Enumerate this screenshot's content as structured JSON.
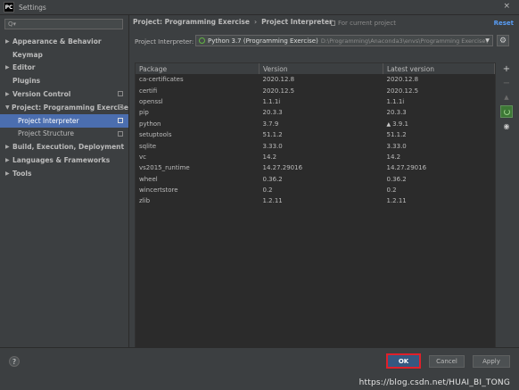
{
  "window": {
    "title": "Settings",
    "app_icon": "PC",
    "close_icon": "×"
  },
  "search": {
    "icon": "Q▾",
    "value": ""
  },
  "sidebar": {
    "items": [
      {
        "label": "Appearance & Behavior",
        "arrow": "▶"
      },
      {
        "label": "Keymap",
        "arrow": ""
      },
      {
        "label": "Editor",
        "arrow": "▶"
      },
      {
        "label": "Plugins",
        "arrow": ""
      },
      {
        "label": "Version Control",
        "arrow": "▶"
      },
      {
        "label": "Project: Programming Exercise",
        "arrow": "▼"
      },
      {
        "label": "Project Interpreter",
        "arrow": ""
      },
      {
        "label": "Project Structure",
        "arrow": ""
      },
      {
        "label": "Build, Execution, Deployment",
        "arrow": "▶"
      },
      {
        "label": "Languages & Frameworks",
        "arrow": "▶"
      },
      {
        "label": "Tools",
        "arrow": "▶"
      }
    ]
  },
  "header": {
    "crumb_project": "Project: Programming Exercise",
    "crumb_sep": "›",
    "crumb_page": "Project Interpreter",
    "current_project": "For current project",
    "reset": "Reset"
  },
  "interpreter": {
    "label": "Project Interpreter:",
    "name": "Python 3.7 (Programming Exercise)",
    "path": "D:\\Programming\\Anaconda3\\envs\\Programming Exercise\\",
    "dropdown_icon": "▼",
    "gear_icon": "⚙"
  },
  "table": {
    "columns": [
      "Package",
      "Version",
      "Latest version"
    ],
    "upgrade_icon": "▲",
    "rows": [
      {
        "package": "ca-certificates",
        "version": "2020.12.8",
        "latest": "2020.12.8",
        "upgrade": false
      },
      {
        "package": "certifi",
        "version": "2020.12.5",
        "latest": "2020.12.5",
        "upgrade": false
      },
      {
        "package": "openssl",
        "version": "1.1.1i",
        "latest": "1.1.1i",
        "upgrade": false
      },
      {
        "package": "pip",
        "version": "20.3.3",
        "latest": "20.3.3",
        "upgrade": false
      },
      {
        "package": "python",
        "version": "3.7.9",
        "latest": "3.9.1",
        "upgrade": true
      },
      {
        "package": "setuptools",
        "version": "51.1.2",
        "latest": "51.1.2",
        "upgrade": false
      },
      {
        "package": "sqlite",
        "version": "3.33.0",
        "latest": "3.33.0",
        "upgrade": false
      },
      {
        "package": "vc",
        "version": "14.2",
        "latest": "14.2",
        "upgrade": false
      },
      {
        "package": "vs2015_runtime",
        "version": "14.27.29016",
        "latest": "14.27.29016",
        "upgrade": false
      },
      {
        "package": "wheel",
        "version": "0.36.2",
        "latest": "0.36.2",
        "upgrade": false
      },
      {
        "package": "wincertstore",
        "version": "0.2",
        "latest": "0.2",
        "upgrade": false
      },
      {
        "package": "zlib",
        "version": "1.2.11",
        "latest": "1.2.11",
        "upgrade": false
      }
    ]
  },
  "tools": {
    "add": "+",
    "remove": "−",
    "upgrade": "▲",
    "show": "◉"
  },
  "footer": {
    "help": "?",
    "ok": "OK",
    "cancel": "Cancel",
    "apply": "Apply"
  },
  "watermark": "https://blog.csdn.net/HUAI_BI_TONG",
  "colors": {
    "background": "#3c3f41",
    "table_bg": "#2b2b2b",
    "selection": "#4b6eaf",
    "link": "#589df6",
    "ok_highlight": "#e0202a"
  }
}
